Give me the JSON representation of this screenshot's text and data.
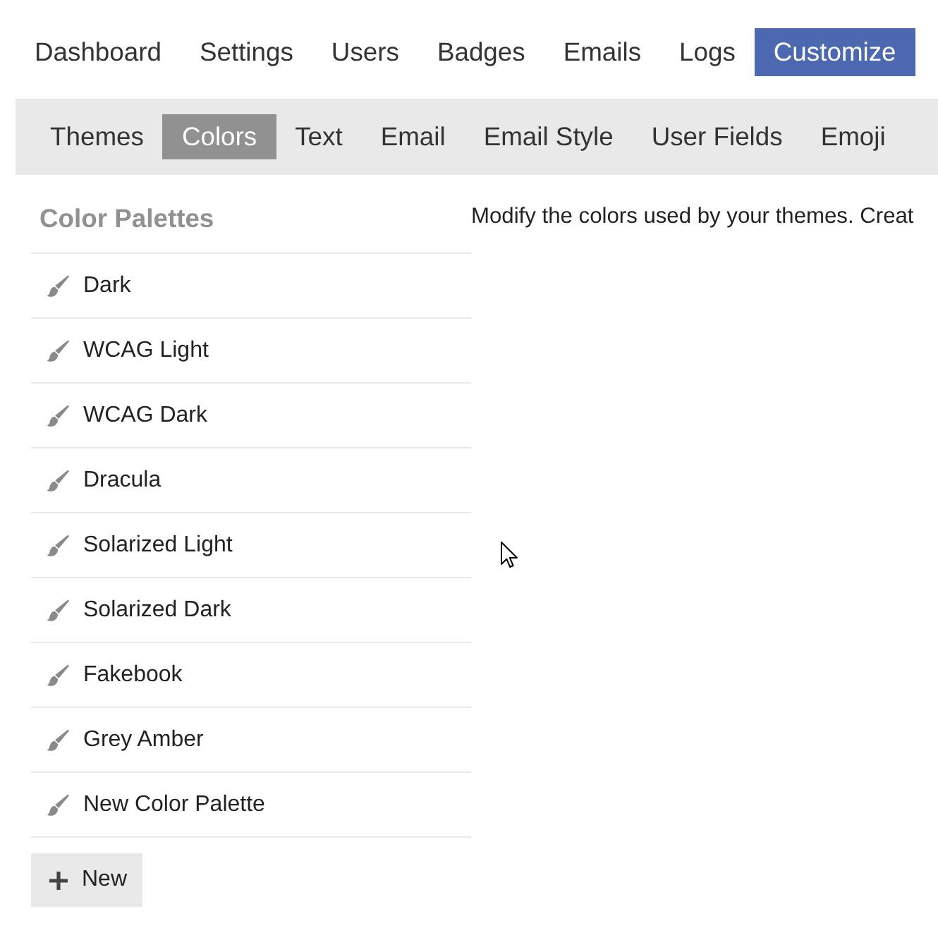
{
  "top_nav": {
    "tabs": [
      {
        "label": "Dashboard",
        "selected": false
      },
      {
        "label": "Settings",
        "selected": false
      },
      {
        "label": "Users",
        "selected": false
      },
      {
        "label": "Badges",
        "selected": false
      },
      {
        "label": "Emails",
        "selected": false
      },
      {
        "label": "Logs",
        "selected": false
      },
      {
        "label": "Customize",
        "selected": true
      }
    ]
  },
  "sub_nav": {
    "tabs": [
      {
        "label": "Themes",
        "selected": false
      },
      {
        "label": "Colors",
        "selected": true
      },
      {
        "label": "Text",
        "selected": false
      },
      {
        "label": "Email",
        "selected": false
      },
      {
        "label": "Email Style",
        "selected": false
      },
      {
        "label": "User Fields",
        "selected": false
      },
      {
        "label": "Emoji",
        "selected": false
      }
    ]
  },
  "sidebar": {
    "title": "Color Palettes",
    "items": [
      {
        "label": "Dark",
        "selected": false
      },
      {
        "label": "WCAG Light",
        "selected": false
      },
      {
        "label": "WCAG Dark",
        "selected": false
      },
      {
        "label": "Dracula",
        "selected": false
      },
      {
        "label": "Solarized Light",
        "selected": false
      },
      {
        "label": "Solarized Dark",
        "selected": false
      },
      {
        "label": "Fakebook",
        "selected": false
      },
      {
        "label": "Grey Amber",
        "selected": false
      },
      {
        "label": "New Color Palette",
        "selected": false
      }
    ],
    "new_button": {
      "label": "New"
    }
  },
  "main": {
    "description": "Modify the colors used by your themes. Creat"
  }
}
